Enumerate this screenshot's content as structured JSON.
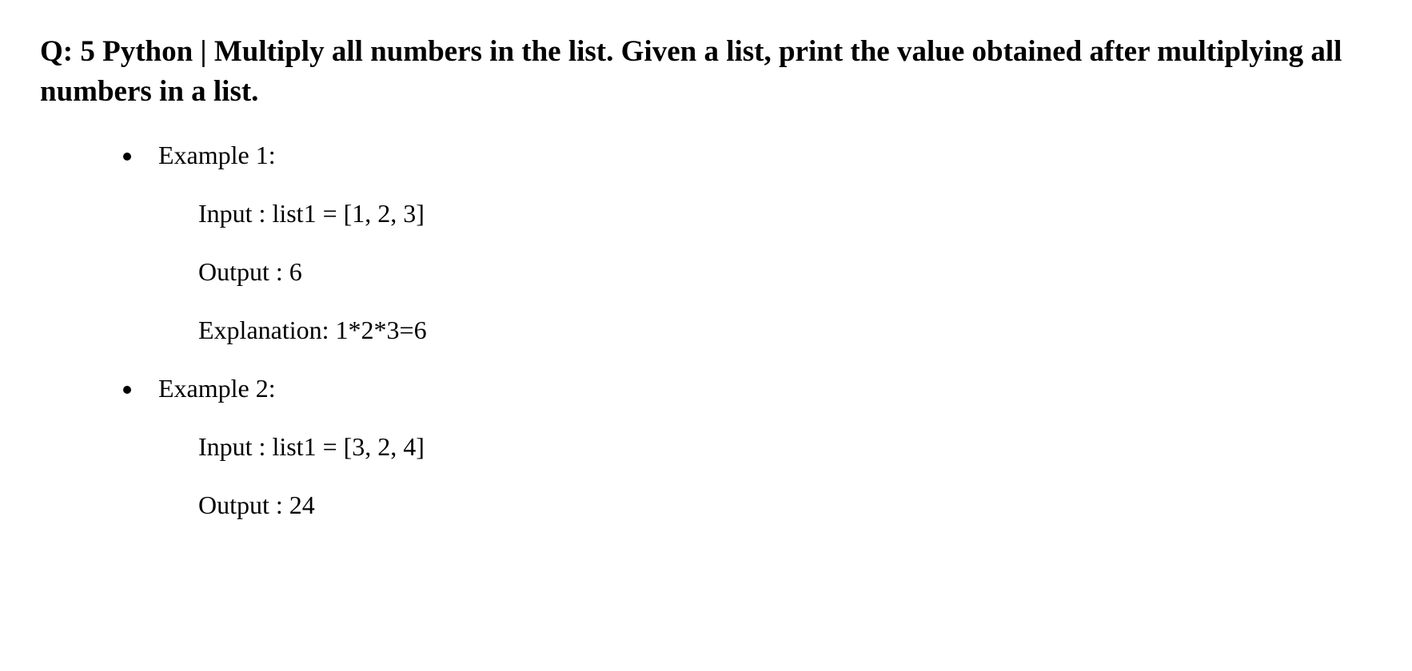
{
  "heading": "Q: 5 Python | Multiply all numbers in the list. Given a list, print the value obtained after multiplying all numbers in a list.",
  "examples": [
    {
      "label": "Example 1:",
      "input": "Input :  list1 = [1, 2, 3]",
      "output": "Output : 6",
      "explanation": "Explanation: 1*2*3=6"
    },
    {
      "label": "Example 2:",
      "input": "Input : list1 = [3, 2, 4]",
      "output": "Output : 24",
      "explanation": ""
    }
  ]
}
